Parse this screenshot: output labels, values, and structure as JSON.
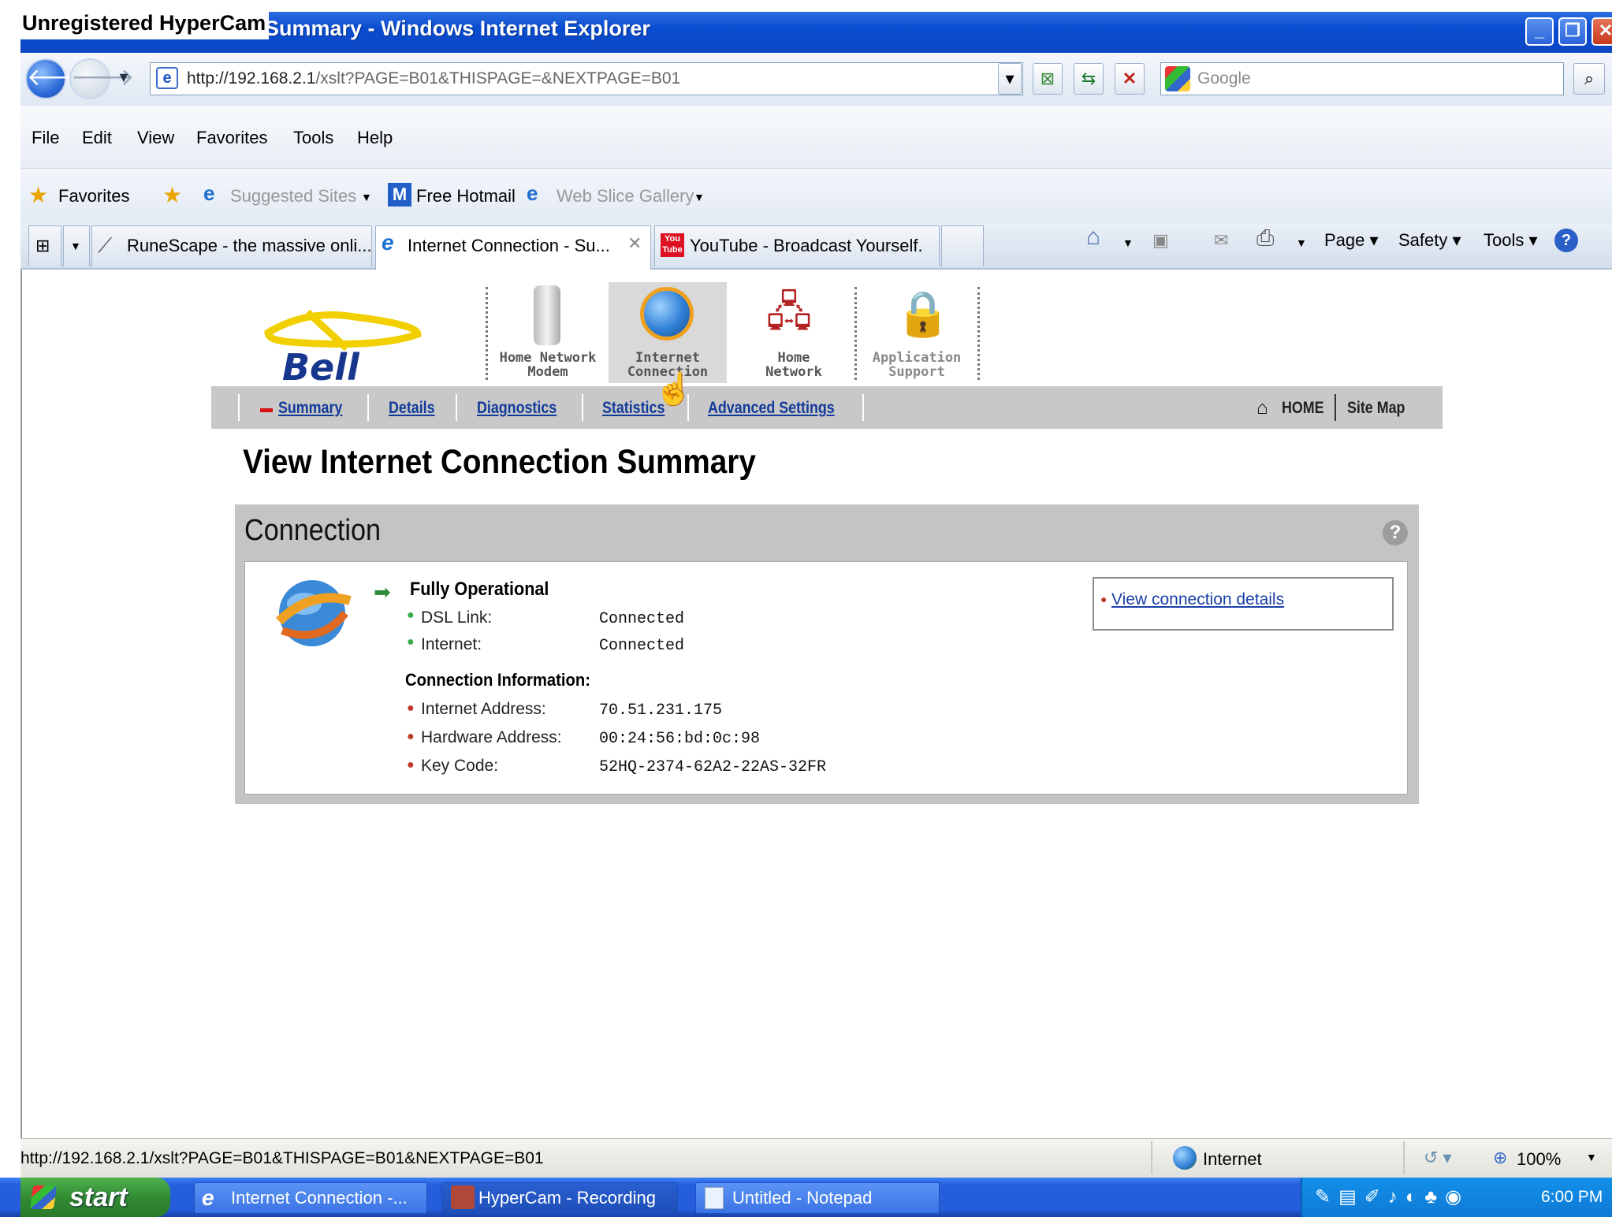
{
  "recorder_label": "Unregistered HyperCam",
  "window": {
    "title": "Summary - Windows Internet Explorer"
  },
  "address": {
    "url_host": "http://192.168.2.1",
    "url_path": "/xslt?PAGE=B01&THISPAGE=&NEXTPAGE=B01"
  },
  "search": {
    "placeholder": "Google"
  },
  "menu": [
    "File",
    "Edit",
    "View",
    "Favorites",
    "Tools",
    "Help"
  ],
  "favorites_bar": {
    "favorites": "Favorites",
    "suggested": "Suggested Sites",
    "hotmail": "Free Hotmail",
    "webslice": "Web Slice Gallery"
  },
  "tabs": [
    {
      "label": "RuneScape - the massive onli..."
    },
    {
      "label": "Internet Connection - Su..."
    },
    {
      "label": "YouTube - Broadcast Yourself."
    }
  ],
  "commands": {
    "page": "Page",
    "safety": "Safety",
    "tools": "Tools"
  },
  "router": {
    "brand": "Bell",
    "nav": [
      {
        "line1": "Home Network",
        "line2": "Modem"
      },
      {
        "line1": "Internet",
        "line2": "Connection"
      },
      {
        "line1": "Home",
        "line2": "Network"
      },
      {
        "line1": "Application",
        "line2": "Support"
      }
    ],
    "subnav": [
      "Summary",
      "Details",
      "Diagnostics",
      "Statistics",
      "Advanced Settings"
    ],
    "home": "HOME",
    "sitemap": "Site Map",
    "heading": "View Internet Connection Summary",
    "panel_title": "Connection",
    "status": "Fully Operational",
    "links": [
      {
        "label": "DSL Link:",
        "value": "Connected"
      },
      {
        "label": "Internet:",
        "value": "Connected"
      }
    ],
    "info_title": "Connection Information:",
    "info": [
      {
        "label": "Internet Address:",
        "value": "70.51.231.175"
      },
      {
        "label": "Hardware Address:",
        "value": "00:24:56:bd:0c:98"
      },
      {
        "label": "Key Code:",
        "value": "52HQ-2374-62A2-22AS-32FR"
      }
    ],
    "details_link": "View connection details"
  },
  "statusbar": {
    "url": "http://192.168.2.1/xslt?PAGE=B01&THISPAGE=B01&NEXTPAGE=B01",
    "zone": "Internet",
    "zoom": "100%"
  },
  "taskbar": {
    "start": "start",
    "items": [
      "Internet Connection -...",
      "HyperCam - Recording",
      "Untitled - Notepad"
    ],
    "clock": "6:00 PM"
  }
}
